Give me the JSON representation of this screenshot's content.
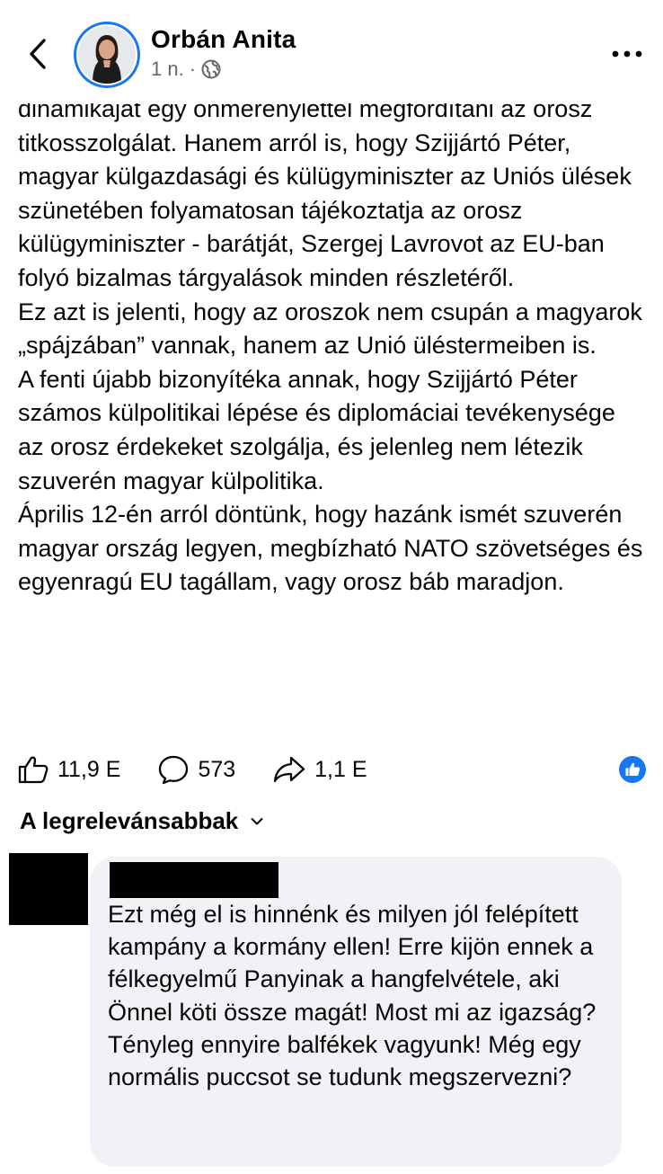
{
  "header": {
    "author_name": "Orbán Anita",
    "post_time": "1 n. ·",
    "icons": {
      "back": "chevron-left-icon",
      "privacy": "globe-icon",
      "more": "more-horizontal-icon"
    }
  },
  "post": {
    "paragraphs": [
      "dinamikáját egy önmerénylettel megfordítani az orosz titkosszolgálat. Hanem arról is, hogy Szijjártó Péter, magyar külgazdasági és külügyminiszter az Uniós ülések szünetében folyamatosan tájékoztatja az orosz külügyminiszter - barátját, Szergej Lavrovot az EU-ban folyó bizalmas tárgyalások minden részletéről.",
      "Ez azt is jelenti, hogy az oroszok nem csupán a magyarok „spájzában” vannak, hanem az Unió üléstermeiben is.",
      "A fenti újabb bizonyítéka annak, hogy Szijjártó Péter számos külpolitikai lépése és diplomáciai tevékenysége az orosz érdekeket szolgálja, és jelenleg nem létezik szuverén magyar külpolitika.",
      "Április 12-én arról döntünk, hogy hazánk ismét szuverén magyar ország legyen, megbízható NATO szövetséges és egyenragú EU tagállam, vagy orosz báb maradjon."
    ]
  },
  "actions": {
    "likes": "11,9 E",
    "comments": "573",
    "shares": "1,1 E",
    "accent_color": "#1877f2"
  },
  "comments_section": {
    "sort_label": "A legrelevánsabbak",
    "comment": {
      "text": "Ezt még el is hinnénk és milyen jól felépített kampány a kormány ellen! Erre kijön ennek a félkegyelmű Panyinak a hangfelvétele, aki Önnel köti össze magát! Most mi az igazság? Tényleg ennyire balfékek vagyunk! Még egy normális puccsot se tudunk megszervezni?"
    }
  }
}
